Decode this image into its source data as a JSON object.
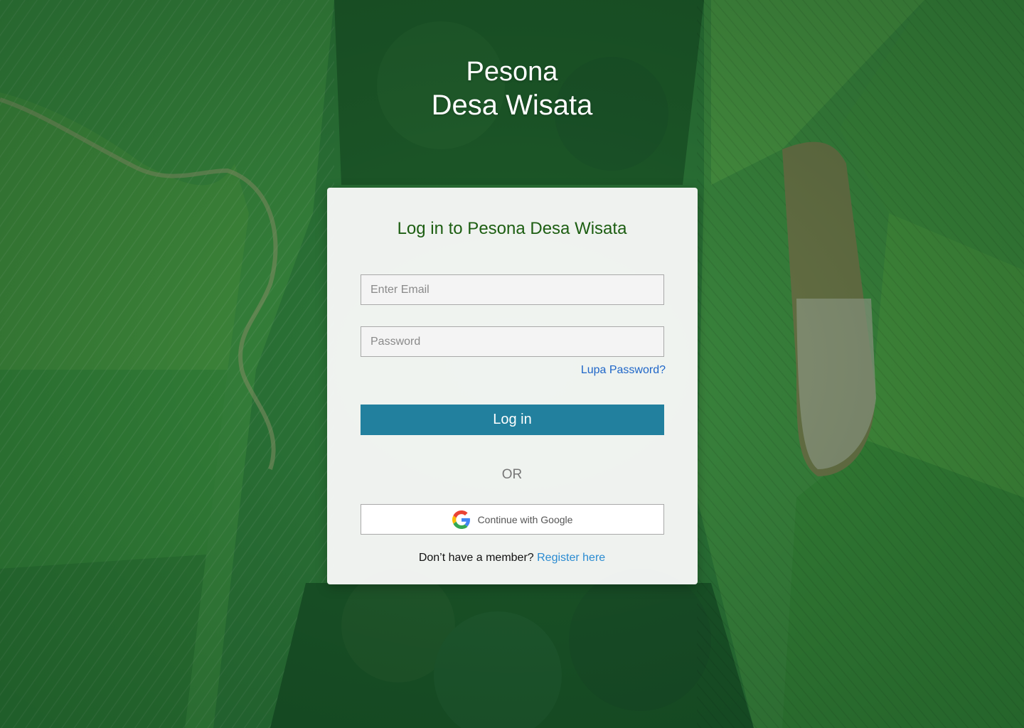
{
  "brand": {
    "line1": "Pesona",
    "line2": "Desa Wisata"
  },
  "login_card": {
    "title": "Log in to Pesona Desa Wisata",
    "email_placeholder": "Enter Email",
    "email_value": "",
    "password_placeholder": "Password",
    "password_value": "",
    "forgot_password": "Lupa Password?",
    "login_button": "Log in",
    "divider": "OR",
    "google_button": "Continue with Google",
    "register_prompt": "Don’t have a member?",
    "register_link": "Register here"
  },
  "colors": {
    "title_green": "#1d5e12",
    "primary_button": "#22809e",
    "link_blue": "#1f66c8",
    "register_blue": "#2a8bd1",
    "background_green": "#2f7a3a"
  },
  "icons": {
    "google": "google-g-icon"
  }
}
